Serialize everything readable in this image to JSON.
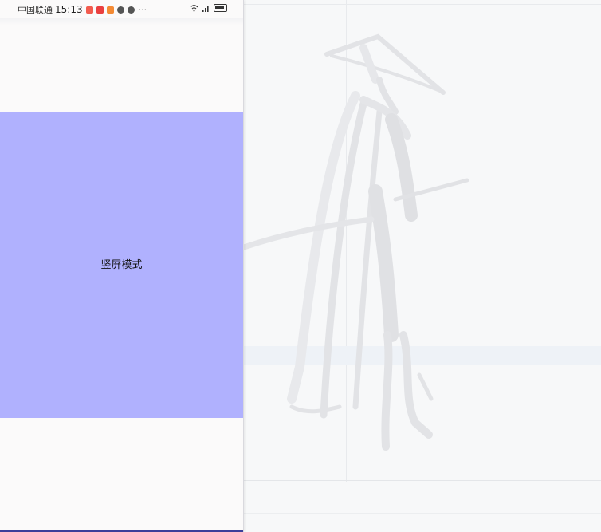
{
  "status_bar": {
    "carrier": "中国联通",
    "time": "15:13",
    "more": "···",
    "signal_icons": [
      "wifi-icon",
      "signal-icon",
      "battery-icon"
    ]
  },
  "main_panel": {
    "label": "竖屏模式",
    "background_color": "#b0b1fe"
  },
  "colors": {
    "phone_background": "#fbfafa",
    "desktop_background": "#f7f8f9",
    "accent_bottom": "#3b3f9a"
  }
}
